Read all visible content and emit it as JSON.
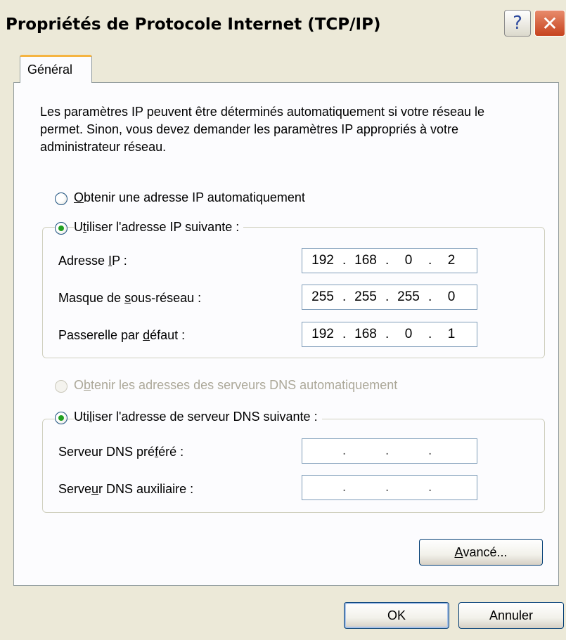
{
  "window": {
    "title": "Propriétés de Protocole Internet (TCP/IP)",
    "help_glyph": "?",
    "close_glyph": "✕"
  },
  "tabs": [
    {
      "label": "Général",
      "selected": true
    }
  ],
  "intro_text": "Les paramètres IP peuvent être déterminés automatiquement si votre réseau le permet. Sinon, vous devez demander les paramètres IP appropriés à votre administrateur réseau.",
  "ip_section": {
    "auto_option": {
      "mnemonic": "O",
      "rest": "btenir une adresse IP automatiquement",
      "checked": false
    },
    "manual_option": {
      "before": "U",
      "mnemonic": "t",
      "rest": "iliser l'adresse IP suivante :",
      "checked": true
    },
    "fields": [
      {
        "before": "Adresse ",
        "mnemonic": "I",
        "after": "P :",
        "octets": [
          "192",
          "168",
          "0",
          "2"
        ]
      },
      {
        "before": "Masque de ",
        "mnemonic": "s",
        "after": "ous-réseau :",
        "octets": [
          "255",
          "255",
          "255",
          "0"
        ]
      },
      {
        "before": "Passerelle par ",
        "mnemonic": "d",
        "after": "éfaut :",
        "octets": [
          "192",
          "168",
          "0",
          "1"
        ]
      }
    ]
  },
  "dns_section": {
    "auto_option": {
      "before": "O",
      "mnemonic": "b",
      "rest": "tenir les adresses des serveurs DNS automatiquement",
      "checked": false,
      "disabled": true
    },
    "manual_option": {
      "before": "Uti",
      "mnemonic": "l",
      "rest": "iser l'adresse de serveur DNS suivante :",
      "checked": true
    },
    "fields": [
      {
        "before": "Serveur DNS pré",
        "mnemonic": "f",
        "after": "éré :",
        "octets": [
          "",
          "",
          "",
          ""
        ]
      },
      {
        "before": "Serve",
        "mnemonic": "u",
        "after": "r DNS auxiliaire :",
        "octets": [
          "",
          "",
          "",
          ""
        ]
      }
    ]
  },
  "buttons": {
    "advanced": {
      "mnemonic": "A",
      "rest": "vancé..."
    },
    "ok": "OK",
    "cancel": "Annuler"
  },
  "colors": {
    "dialog_bg": "#ece9d8",
    "panel_bg": "#fcfcfe",
    "tab_highlight": "#f5b441",
    "radio_dot": "#21a121",
    "close_red": "#c6431e"
  }
}
